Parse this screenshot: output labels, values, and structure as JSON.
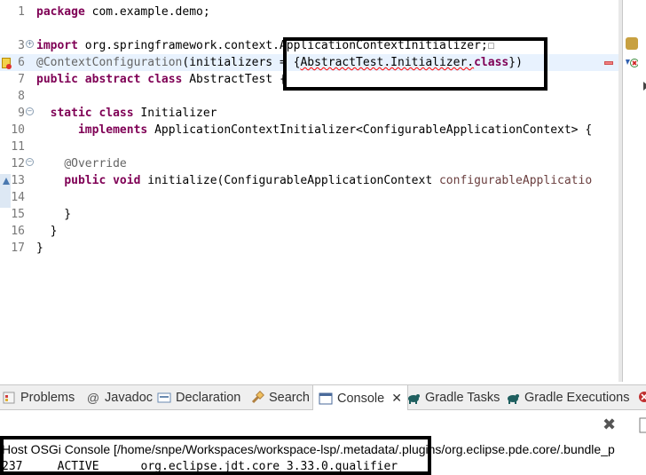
{
  "editor": {
    "lines": [
      {
        "num": "1",
        "parts": [
          {
            "t": "package",
            "c": "kw"
          },
          {
            "t": " com.example.demo;",
            "c": ""
          }
        ]
      },
      {
        "num": "",
        "parts": []
      },
      {
        "num": "3",
        "parts": [
          {
            "t": "import",
            "c": "kw"
          },
          {
            "t": " org.springframework.context.ApplicationContextInitializer;",
            "c": ""
          },
          {
            "t": "☐",
            "c": "ann"
          }
        ]
      },
      {
        "num": "6",
        "parts": [
          {
            "t": "@ContextConfiguration",
            "c": "ann"
          },
          {
            "t": "(initializers = {",
            "c": ""
          },
          {
            "t": "AbstractTest.Initializer.",
            "c": "err"
          },
          {
            "t": "class",
            "c": "kw"
          },
          {
            "t": "})",
            "c": ""
          }
        ]
      },
      {
        "num": "7",
        "parts": [
          {
            "t": "public",
            "c": "kw"
          },
          {
            "t": " ",
            "c": ""
          },
          {
            "t": "abstract",
            "c": "kw"
          },
          {
            "t": " ",
            "c": ""
          },
          {
            "t": "class",
            "c": "kw"
          },
          {
            "t": " AbstractTest {",
            "c": ""
          }
        ]
      },
      {
        "num": "8",
        "parts": []
      },
      {
        "num": "9",
        "parts": [
          {
            "t": "  ",
            "c": ""
          },
          {
            "t": "static",
            "c": "kw"
          },
          {
            "t": " ",
            "c": ""
          },
          {
            "t": "class",
            "c": "kw"
          },
          {
            "t": " Initializer",
            "c": ""
          }
        ]
      },
      {
        "num": "10",
        "parts": [
          {
            "t": "      ",
            "c": ""
          },
          {
            "t": "implements",
            "c": "kw"
          },
          {
            "t": " ApplicationContextInitializer<ConfigurableApplicationContext> {",
            "c": ""
          }
        ]
      },
      {
        "num": "11",
        "parts": []
      },
      {
        "num": "12",
        "parts": [
          {
            "t": "    ",
            "c": ""
          },
          {
            "t": "@Override",
            "c": "ann"
          }
        ]
      },
      {
        "num": "13",
        "parts": [
          {
            "t": "    ",
            "c": ""
          },
          {
            "t": "public",
            "c": "kw"
          },
          {
            "t": " ",
            "c": ""
          },
          {
            "t": "void",
            "c": "kw"
          },
          {
            "t": " initialize(ConfigurableApplicationContext ",
            "c": ""
          },
          {
            "t": "configurableApplicatio",
            "c": "param"
          }
        ]
      },
      {
        "num": "14",
        "parts": []
      },
      {
        "num": "15",
        "parts": [
          {
            "t": "    }",
            "c": ""
          }
        ]
      },
      {
        "num": "16",
        "parts": [
          {
            "t": "  }",
            "c": ""
          }
        ]
      },
      {
        "num": "17",
        "parts": [
          {
            "t": "}",
            "c": ""
          }
        ]
      }
    ]
  },
  "tabs": [
    {
      "label": "Problems",
      "icon": "problems-icon"
    },
    {
      "label": "Javadoc",
      "icon": "javadoc-icon",
      "glyph": "@"
    },
    {
      "label": "Declaration",
      "icon": "declaration-icon"
    },
    {
      "label": "Search",
      "icon": "search-icon"
    },
    {
      "label": "Console",
      "icon": "console-icon",
      "active": true
    },
    {
      "label": "Gradle Tasks",
      "icon": "gradle-icon"
    },
    {
      "label": "Gradle Executions",
      "icon": "gradle-icon"
    }
  ],
  "console": {
    "title": "Host OSGi Console [/home/snpe/Workspaces/workspace-lsp/.metadata/.plugins/org.eclipse.pde.core/.bundle_p",
    "line": "237     ACTIVE      org.eclipse.jdt.core_3.33.0.qualifier",
    "close_glyph": "✖"
  },
  "colors": {
    "keyword": "#7f0055",
    "annotation": "#646464",
    "current_line": "#e8f2fe",
    "highlight_box": "#000000"
  }
}
